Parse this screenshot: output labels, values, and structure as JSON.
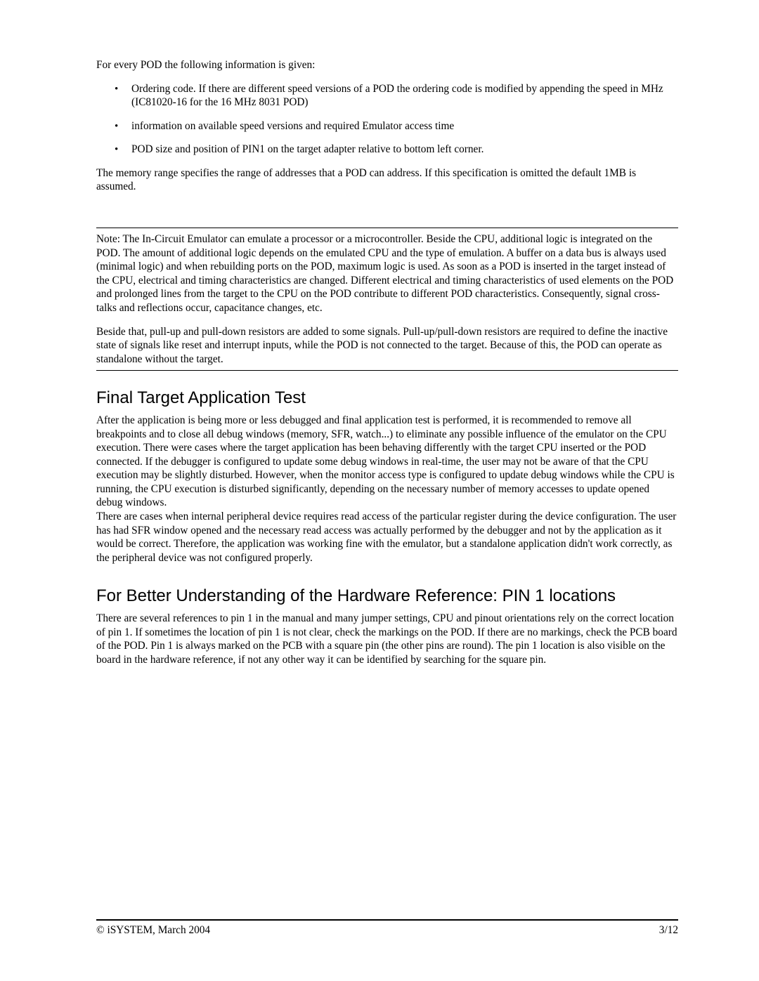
{
  "intro": "For every POD the following information is given:",
  "bullets": [
    "Ordering code. If there are different speed versions of a POD the ordering code is modified by appending the speed in MHz (IC81020-16 for the 16 MHz 8031 POD)",
    "information on available speed versions and required Emulator access time",
    "POD size and position of PIN1 on the target adapter relative to bottom left corner."
  ],
  "afterList": "The memory range specifies the range of addresses that a POD can address. If this specification is omitted the default 1MB is assumed.",
  "note": {
    "p1": "Note: The In-Circuit Emulator can emulate a processor or a microcontroller. Beside the CPU, additional logic is integrated on the POD. The amount of additional logic depends on the emulated CPU and the type of emulation. A buffer on a data bus is always used (minimal logic) and when rebuilding ports on the POD, maximum logic is used. As soon as a POD is inserted in the target instead of the CPU, electrical and timing characteristics are changed. Different electrical and timing characteristics of used elements on the POD and prolonged lines from the target to the CPU on the POD contribute to different POD characteristics. Consequently, signal cross-talks and reflections occur, capacitance changes, etc.",
    "p2": "Beside that, pull-up and pull-down resistors are added to some signals. Pull-up/pull-down resistors are required to define the inactive state of signals like reset and interrupt inputs, while the POD is not connected to the target. Because of this, the POD can operate as standalone without the target."
  },
  "section1": {
    "title": "Final Target Application Test",
    "p1": "After the application is being more or less debugged and final application test is performed, it is recommended to remove all breakpoints and to close all debug windows (memory, SFR, watch...) to eliminate any possible influence of the emulator on the CPU execution. There were cases where the target application has been behaving differently with the target CPU inserted or the POD connected. If the debugger is configured to update some debug windows in real-time, the user may not be aware of that the CPU execution may be slightly disturbed. However, when the monitor access type is configured to update debug windows while the CPU is running, the CPU execution is disturbed significantly, depending on the necessary number of memory accesses to update opened debug windows.",
    "p2": "There are cases when internal peripheral device requires read access of the particular register during the device configuration. The user has had SFR window opened and the necessary read access was actually performed by the debugger and not by the application as it would be correct. Therefore, the application was working fine with the emulator, but a standalone application didn't work correctly, as the peripheral device was not configured properly."
  },
  "section2": {
    "title": "For Better Understanding of the Hardware Reference: PIN 1 locations",
    "p1": "There are several references to pin 1 in the manual and many jumper settings, CPU and pinout orientations rely on the correct location of pin 1. If sometimes the location of pin 1 is not clear, check the markings on the POD. If there are no markings, check the PCB board of the POD. Pin 1 is always marked on the PCB with a square pin (the other pins are round). The pin 1 location is also visible on the board in the hardware reference, if not any other way it can be identified by searching for the square pin."
  },
  "footer": {
    "left": "© iSYSTEM, March 2004",
    "right": "3/12"
  }
}
